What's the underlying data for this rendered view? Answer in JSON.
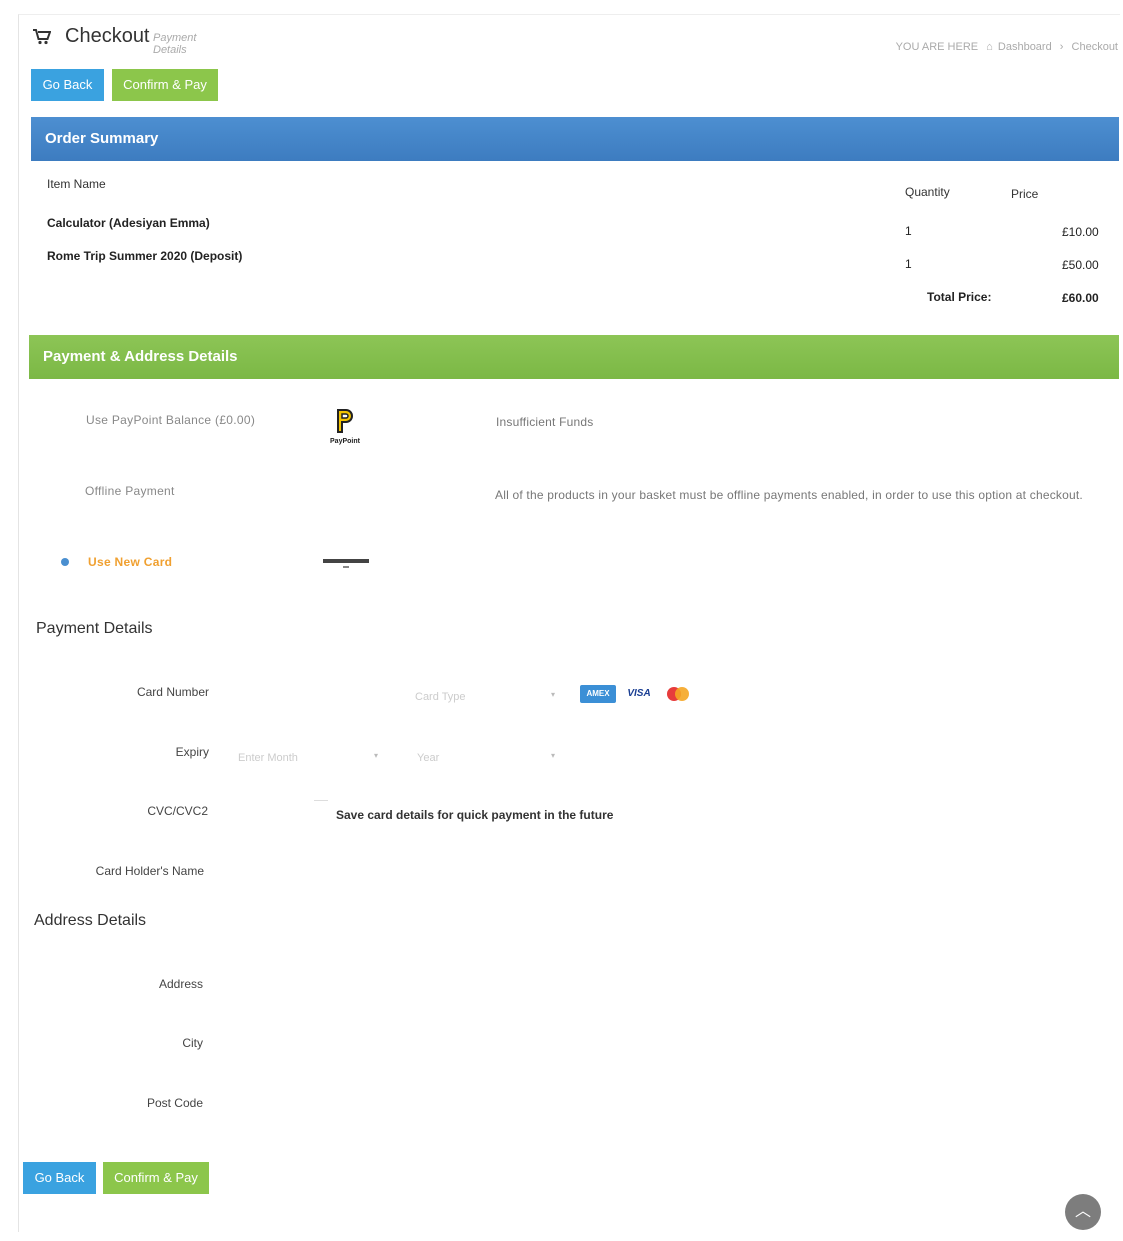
{
  "header": {
    "title": "Checkout",
    "subtitle": "Payment Details",
    "breadcrumb": {
      "prefix": "YOU ARE HERE",
      "home": "Dashboard",
      "separator": "›",
      "current": "Checkout"
    }
  },
  "buttons": {
    "go_back": "Go Back",
    "confirm_pay": "Confirm & Pay"
  },
  "order_summary": {
    "title": "Order Summary",
    "columns": {
      "item": "Item Name",
      "quantity": "Quantity",
      "price": "Price"
    },
    "items": [
      {
        "name": "Calculator (Adesiyan Emma)",
        "quantity": "1",
        "price": "£10.00"
      },
      {
        "name": "Rome Trip Summer 2020 (Deposit)",
        "quantity": "1",
        "price": "£50.00"
      }
    ],
    "total_label": "Total Price:",
    "total_value": "£60.00"
  },
  "payment_address": {
    "title": "Payment & Address Details",
    "options": [
      {
        "label": "Use PayPoint Balance (£0.00)",
        "logo_text": "PayPoint",
        "note": "Insufficient Funds"
      },
      {
        "label": "Offline Payment",
        "note": "All of the products in your basket must be offline payments enabled, in order to use this option at checkout."
      },
      {
        "label": "Use New Card",
        "selected": true
      }
    ]
  },
  "payment_details": {
    "title": "Payment Details",
    "card_number_label": "Card Number",
    "card_type_placeholder": "Card Type",
    "card_icons": [
      "amex-card-icon",
      "visa-card-icon",
      "mastercard-card-icon"
    ],
    "card_texts": {
      "amex": "AMEX",
      "visa": "VISA"
    },
    "expiry_label": "Expiry",
    "month_placeholder": "Enter Month",
    "year_placeholder": "Year",
    "cvc_label": "CVC/CVC2",
    "save_card_label": "Save card details for quick payment in the future",
    "holder_label": "Card Holder's Name"
  },
  "address_details": {
    "title": "Address Details",
    "address_label": "Address",
    "city_label": "City",
    "postcode_label": "Post Code"
  },
  "colors": {
    "blue": "#3aa2e0",
    "green": "#8cc64b",
    "header_blue": "#4d8fd1",
    "header_green": "#8dc556",
    "selected_orange": "#f0a030"
  }
}
